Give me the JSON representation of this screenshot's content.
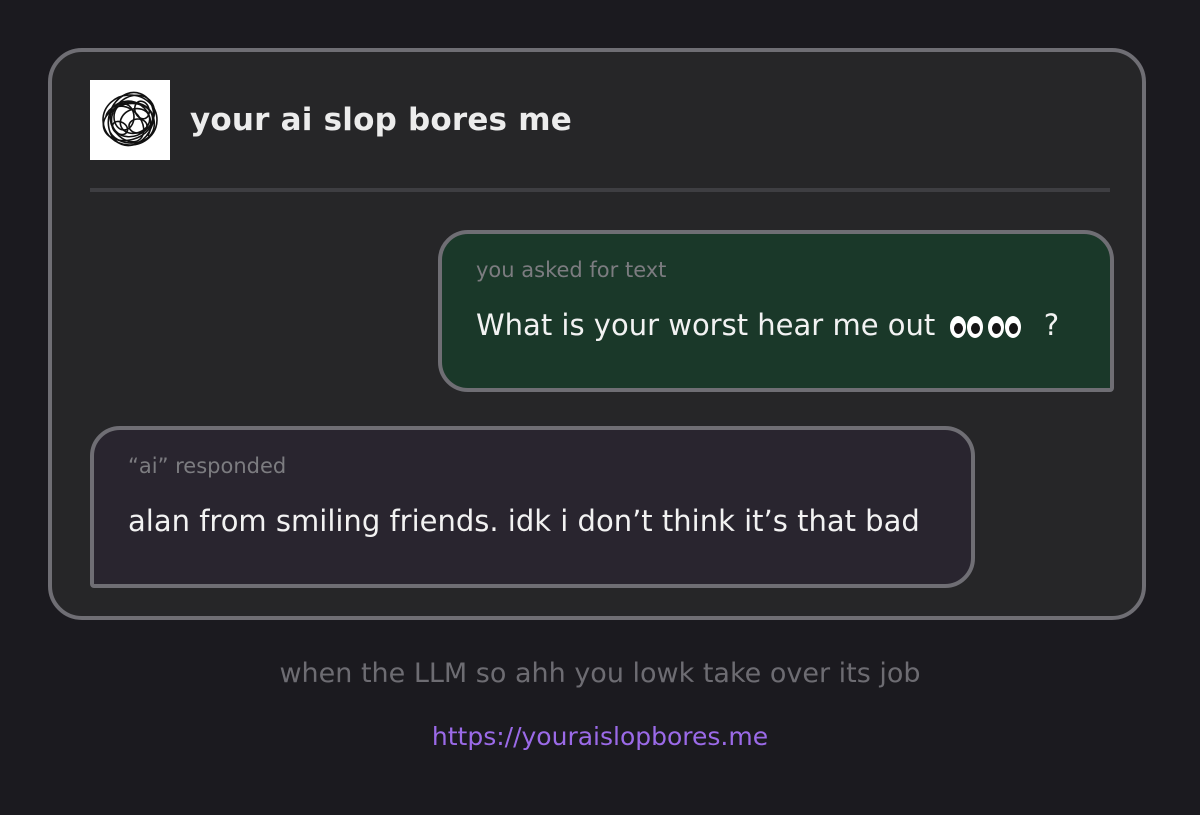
{
  "header": {
    "title": "your ai slop bores me"
  },
  "messages": [
    {
      "role": "user",
      "label": "you asked for text",
      "text_before": "What is your worst hear me out",
      "emoji": "eyes-emoji",
      "text_after": "?"
    },
    {
      "role": "ai",
      "label": "“ai” responded",
      "text": "alan from smiling friends. idk i don’t think it’s that bad"
    }
  ],
  "footer": {
    "caption": "when the LLM so ahh you lowk take over its job",
    "link": "https://youraislopbores.me"
  },
  "colors": {
    "background": "#1b1a1f",
    "card": "#262628",
    "user_bubble": "#1a3829",
    "ai_bubble": "#29252f",
    "link": "#9b6ae8"
  }
}
